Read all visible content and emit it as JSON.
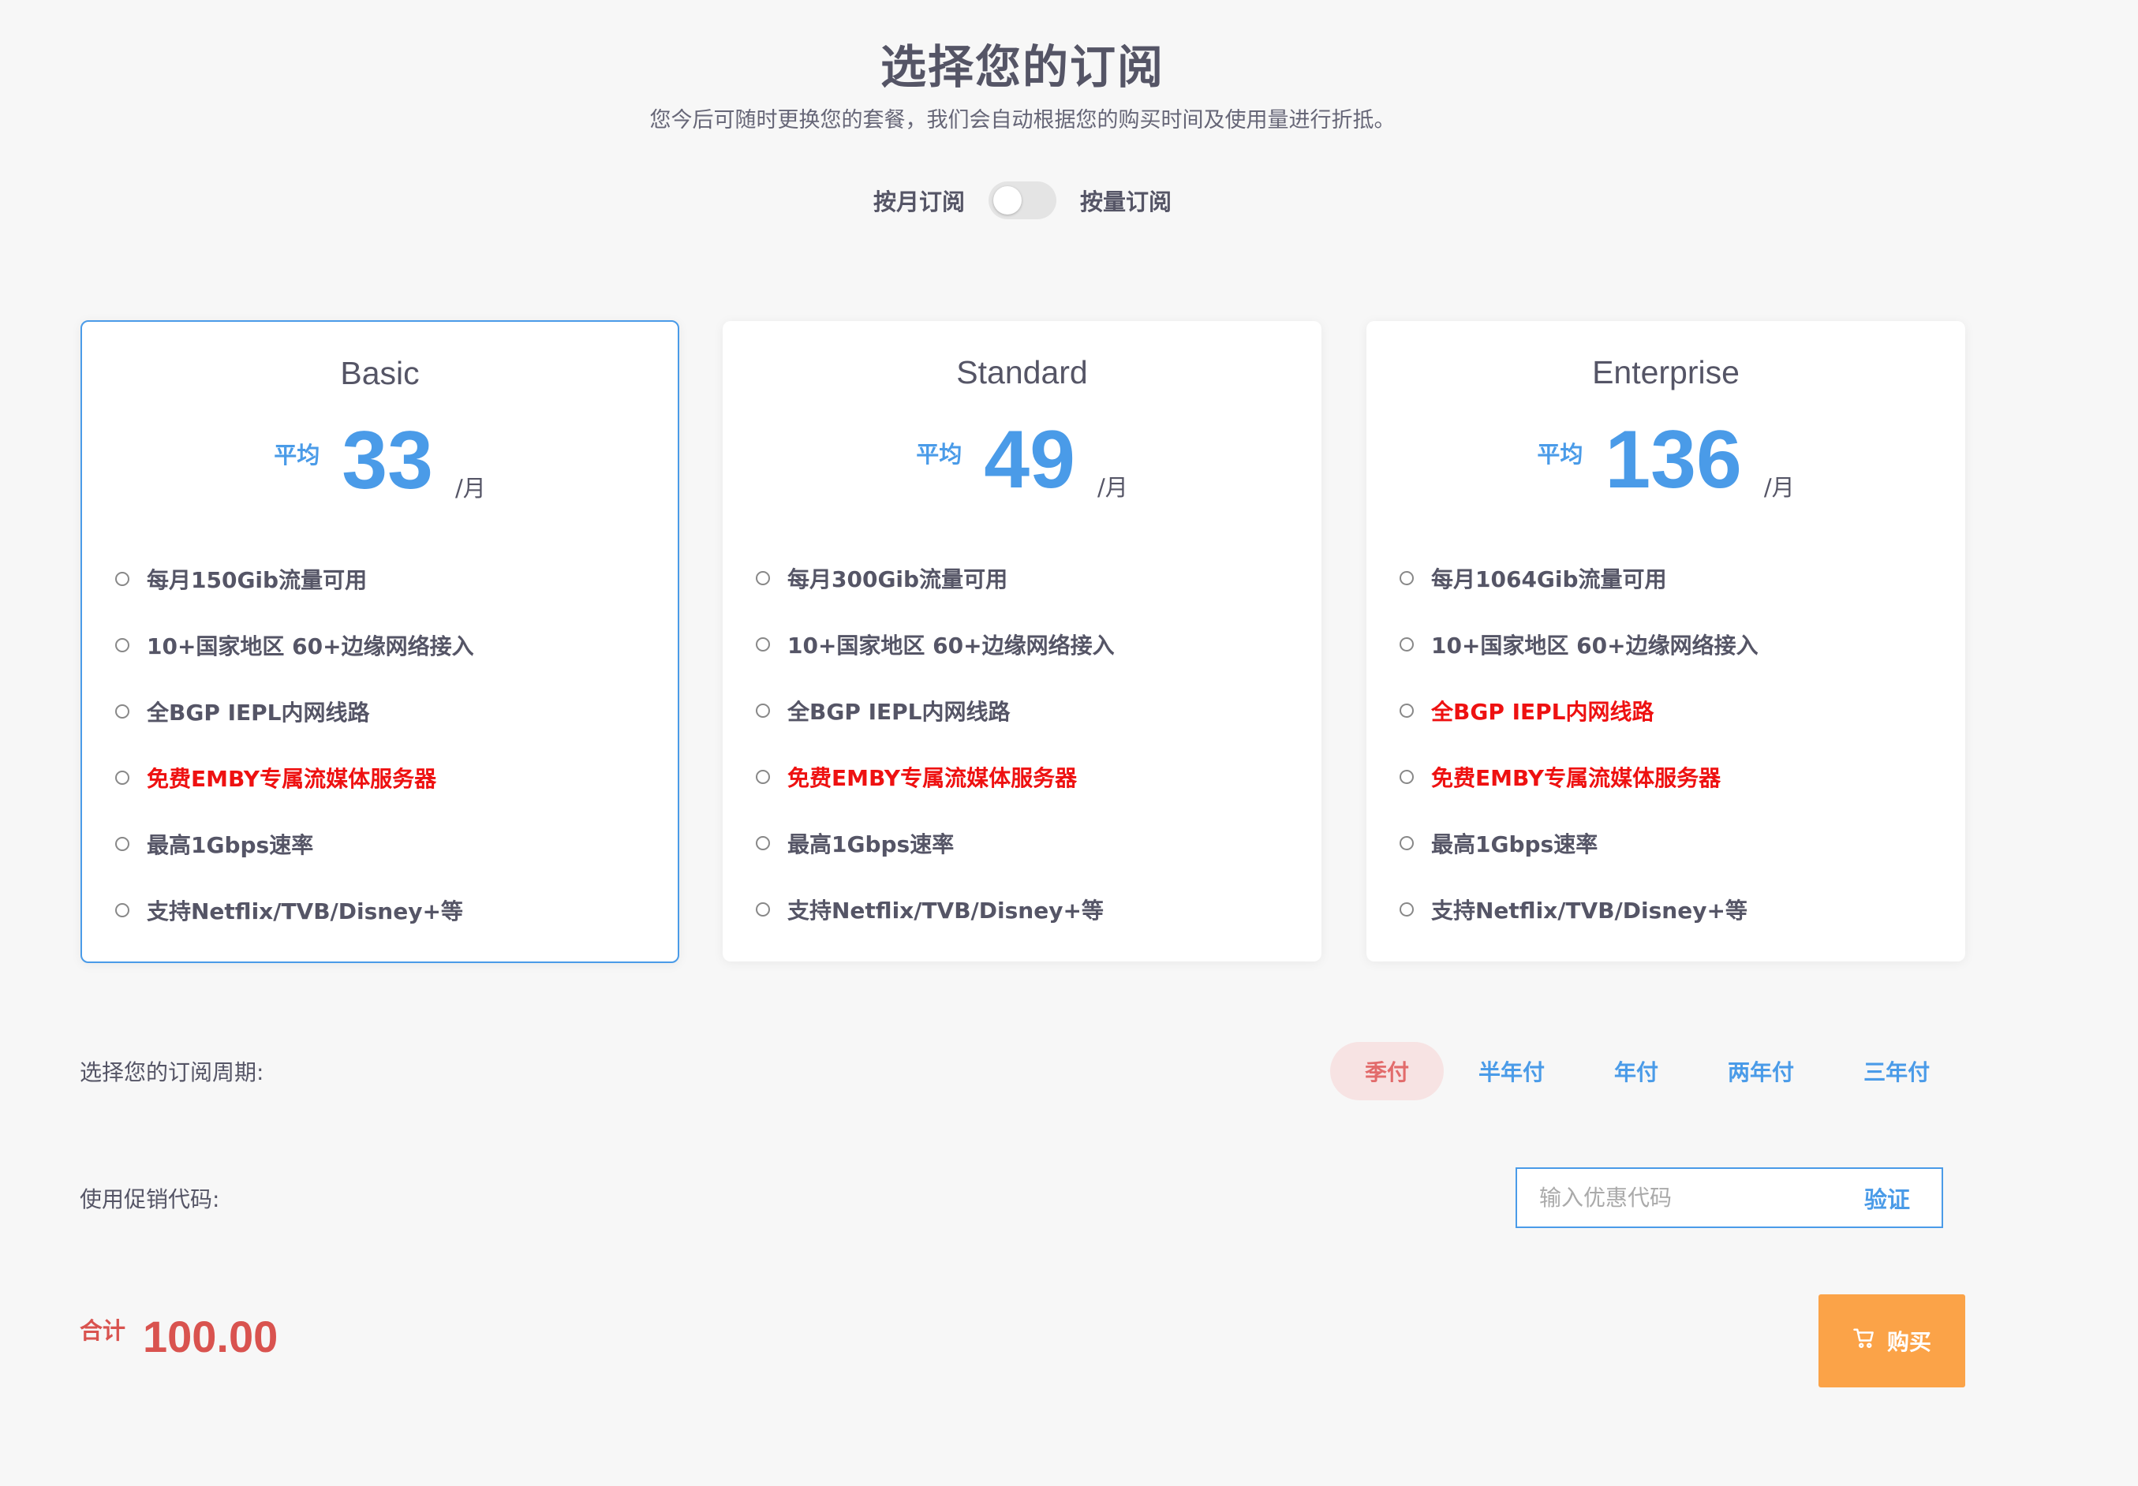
{
  "header": {
    "title": "选择您的订阅",
    "subtitle": "您今后可随时更换您的套餐，我们会自动根据您的购买时间及使用量进行折抵。"
  },
  "billing_toggle": {
    "left_label": "按月订阅",
    "right_label": "按量订阅",
    "on": false
  },
  "plans": [
    {
      "name": "Basic",
      "price_prefix": "平均",
      "price": "33",
      "price_unit": "/月",
      "selected": true,
      "features": [
        {
          "text": "每月150Gib流量可用",
          "highlight": false
        },
        {
          "text": "10+国家地区 60+边缘网络接入",
          "highlight": false
        },
        {
          "text": "全BGP IEPL内网线路",
          "highlight": false
        },
        {
          "text": "免费EMBY专属流媒体服务器",
          "highlight": true
        },
        {
          "text": "最高1Gbps速率",
          "highlight": false
        },
        {
          "text": "支持Netflix/TVB/Disney+等",
          "highlight": false
        }
      ]
    },
    {
      "name": "Standard",
      "price_prefix": "平均",
      "price": "49",
      "price_unit": "/月",
      "selected": false,
      "features": [
        {
          "text": "每月300Gib流量可用",
          "highlight": false
        },
        {
          "text": "10+国家地区 60+边缘网络接入",
          "highlight": false
        },
        {
          "text": "全BGP IEPL内网线路",
          "highlight": false
        },
        {
          "text": "免费EMBY专属流媒体服务器",
          "highlight": true
        },
        {
          "text": "最高1Gbps速率",
          "highlight": false
        },
        {
          "text": "支持Netflix/TVB/Disney+等",
          "highlight": false
        }
      ]
    },
    {
      "name": "Enterprise",
      "price_prefix": "平均",
      "price": "136",
      "price_unit": "/月",
      "selected": false,
      "features": [
        {
          "text": "每月1064Gib流量可用",
          "highlight": false
        },
        {
          "text": "10+国家地区 60+边缘网络接入",
          "highlight": false
        },
        {
          "text": "全BGP IEPL内网线路",
          "highlight": true
        },
        {
          "text": "免费EMBY专属流媒体服务器",
          "highlight": true
        },
        {
          "text": "最高1Gbps速率",
          "highlight": false
        },
        {
          "text": "支持Netflix/TVB/Disney+等",
          "highlight": false
        }
      ]
    }
  ],
  "cycle": {
    "label": "选择您的订阅周期:",
    "options": [
      "季付",
      "半年付",
      "年付",
      "两年付",
      "三年付"
    ],
    "active_index": 0
  },
  "promo": {
    "label": "使用促销代码:",
    "placeholder": "输入优惠代码",
    "value": "",
    "verify_label": "验证"
  },
  "total": {
    "label": "合计",
    "value": "100.00"
  },
  "buy": {
    "label": "购买",
    "icon": "cart-icon"
  },
  "colors": {
    "accent": "#4a9be8",
    "highlight_text": "#ee1111",
    "total": "#d9534f",
    "buy_button": "#fba348",
    "active_cycle_bg": "#f7e3e3",
    "active_cycle_text": "#e26b6b"
  }
}
